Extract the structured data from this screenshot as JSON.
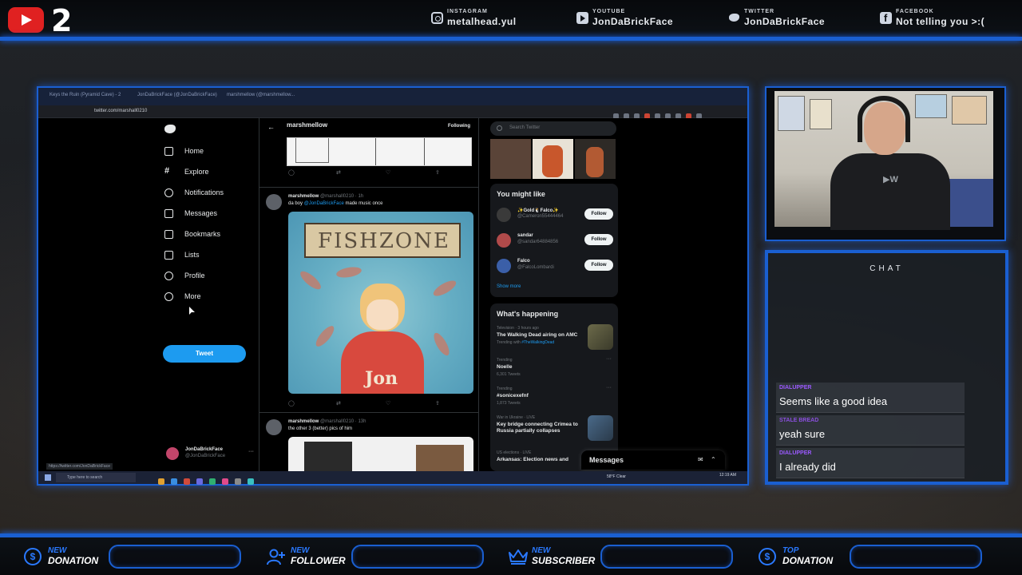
{
  "overlay": {
    "stream_number": "2",
    "socials": [
      {
        "label": "INSTAGRAM",
        "handle": "metalhead.yul",
        "icon": "instagram-icon"
      },
      {
        "label": "YOUTUBE",
        "handle": "JonDaBrickFace",
        "icon": "youtube-icon"
      },
      {
        "label": "TWITTER",
        "handle": "JonDaBrickFace",
        "icon": "twitter-icon"
      },
      {
        "label": "FACEBOOK",
        "handle": "Not telling you >:(",
        "icon": "facebook-icon"
      }
    ],
    "colors": {
      "accent": "#1a5fd1",
      "alert_blue": "#2a79ff",
      "youtube_red": "#e02121",
      "chat_user": "#9b59ff"
    }
  },
  "browser": {
    "tabs": [
      "Keys the Ruin (Pyramid Cave) - 2",
      "JonDaBrickFace (@JonDaBrickFace)",
      "marshmellow (@marshmellow..."
    ],
    "url": "twitter.com/marshall0210",
    "status_url": "https://twitter.com/JonDaBrickFace"
  },
  "twitter": {
    "nav": [
      {
        "label": "Home",
        "icon": "home-icon"
      },
      {
        "label": "Explore",
        "icon": "hashtag-icon"
      },
      {
        "label": "Notifications",
        "icon": "bell-icon"
      },
      {
        "label": "Messages",
        "icon": "mail-icon"
      },
      {
        "label": "Bookmarks",
        "icon": "bookmark-icon"
      },
      {
        "label": "Lists",
        "icon": "list-icon"
      },
      {
        "label": "Profile",
        "icon": "profile-icon"
      },
      {
        "label": "More",
        "icon": "more-icon"
      }
    ],
    "tweet_button": "Tweet",
    "account": {
      "name": "JonDaBrickFace",
      "handle": "@JonDaBrickFace"
    },
    "profile_header": {
      "title": "marshmellow",
      "following": "Following"
    },
    "tweets": [
      {
        "name": "marshmellow",
        "handle": "@marshall0210 · 1h",
        "text_pre": "da boy ",
        "mention": "@JonDaBrickFace",
        "text_post": " made music once",
        "image_title": "FISHZONE",
        "image_name": "Jon"
      },
      {
        "name": "marshmellow",
        "handle": "@marshall0210 · 13h",
        "text_pre": "the other 3 (better) pics of him",
        "mention": "",
        "text_post": ""
      }
    ],
    "search_placeholder": "Search Twitter",
    "you_might_like": {
      "title": "You might like",
      "users": [
        {
          "name": "✨Gold🐧Falco✨",
          "handle": "@Cameron55444464",
          "button": "Follow"
        },
        {
          "name": "sandar",
          "handle": "@sandar64884856",
          "button": "Follow"
        },
        {
          "name": "Falco",
          "handle": "@FalcoLombardi",
          "button": "Follow"
        }
      ],
      "show_more": "Show more"
    },
    "whats_happening": {
      "title": "What's happening",
      "trends": [
        {
          "meta": "Television · 3 hours ago",
          "title": "The Walking Dead airing on AMC",
          "sub_pre": "Trending with ",
          "sub_link": "#TheWalkingDead",
          "thumb": true
        },
        {
          "meta": "Trending",
          "title": "Noelle",
          "sub_pre": "6,301 Tweets",
          "sub_link": "",
          "thumb": false
        },
        {
          "meta": "Trending",
          "title": "#sonicexefnf",
          "sub_pre": "1,873 Tweets",
          "sub_link": "",
          "thumb": false
        },
        {
          "meta": "War in Ukraine · LIVE",
          "title": "Key bridge connecting Crimea to Russia partially collapses",
          "sub_pre": "",
          "sub_link": "",
          "thumb": true
        },
        {
          "meta": "US elections · LIVE",
          "title": "Arkansas: Election news and",
          "sub_pre": "",
          "sub_link": "",
          "thumb": false
        }
      ]
    },
    "messages_drawer": "Messages"
  },
  "taskbar": {
    "search_placeholder": "Type here to search",
    "weather": "58°F Clear",
    "time": "12:19 AM"
  },
  "chat": {
    "title": "CHAT",
    "messages": [
      {
        "user": "DIALUPPER",
        "text": "Seems like a good idea"
      },
      {
        "user": "STALE BREAD",
        "text": "yeah sure"
      },
      {
        "user": "DIALUPPER",
        "text": "I already did"
      }
    ]
  },
  "alerts": [
    {
      "new": "NEW",
      "type": "DONATION",
      "icon": "dollar-icon"
    },
    {
      "new": "NEW",
      "type": "FOLLOWER",
      "icon": "add-person-icon"
    },
    {
      "new": "NEW",
      "type": "SUBSCRIBER",
      "icon": "crown-icon"
    },
    {
      "new": "TOP",
      "type": "DONATION",
      "icon": "dollar-icon"
    }
  ]
}
